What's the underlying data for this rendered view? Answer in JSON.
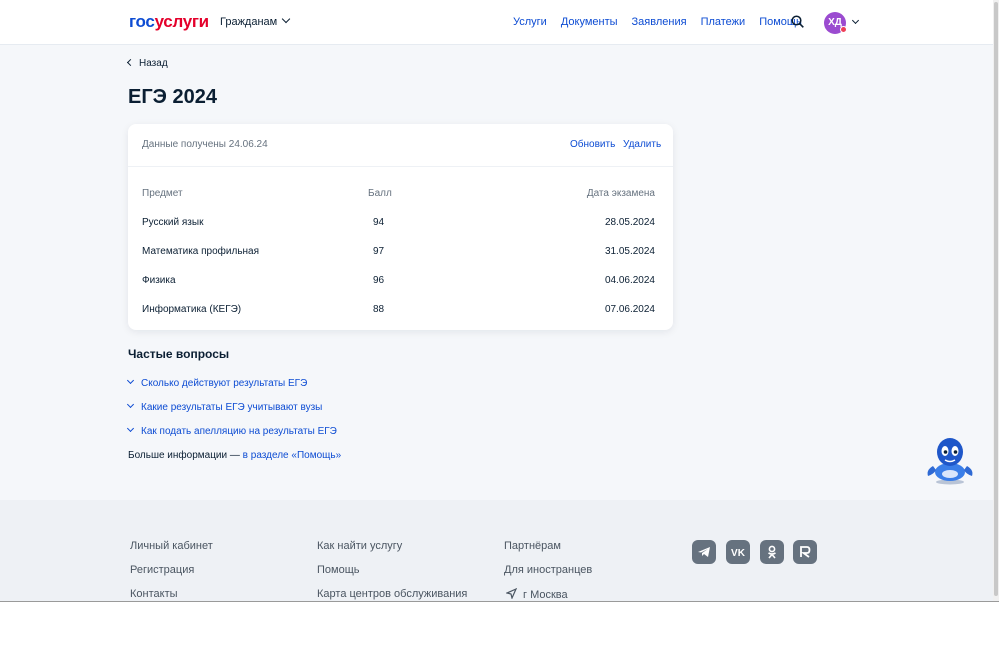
{
  "header": {
    "logo_part1": "гос",
    "logo_part2": "услуги",
    "role_selector": "Гражданам",
    "nav": [
      "Услуги",
      "Документы",
      "Заявления",
      "Платежи",
      "Помощь"
    ],
    "avatar_initials": "ХД"
  },
  "page": {
    "back_label": "Назад",
    "title": "ЕГЭ 2024"
  },
  "results_card": {
    "received_text": "Данные получены 24.06.24",
    "refresh_label": "Обновить",
    "delete_label": "Удалить",
    "columns": [
      "Предмет",
      "Балл",
      "Дата экзамена"
    ],
    "rows": [
      {
        "subject": "Русский язык",
        "score": "94",
        "date": "28.05.2024"
      },
      {
        "subject": "Математика профильная",
        "score": "97",
        "date": "31.05.2024"
      },
      {
        "subject": "Физика",
        "score": "96",
        "date": "04.06.2024"
      },
      {
        "subject": "Информатика (КЕГЭ)",
        "score": "88",
        "date": "07.06.2024"
      }
    ]
  },
  "faq": {
    "title": "Частые вопросы",
    "items": [
      "Сколько действуют результаты ЕГЭ",
      "Какие результаты ЕГЭ учитывают вузы",
      "Как подать апелляцию на результаты ЕГЭ"
    ],
    "more_prefix": "Больше информации — ",
    "more_link": "в разделе «Помощь»"
  },
  "footer": {
    "col1": [
      "Личный кабинет",
      "Регистрация",
      "Контакты"
    ],
    "col2": [
      "Как найти услугу",
      "Помощь",
      "Карта центров обслуживания"
    ],
    "col3": [
      "Партнёрам",
      "Для иностранцев"
    ],
    "location": "г Москва",
    "social_icons": [
      "telegram-icon",
      "vk-icon",
      "odnoklassniki-icon",
      "rutube-icon"
    ]
  },
  "colors": {
    "brand_blue": "#0d4cd3",
    "brand_red": "#e4002b",
    "text": "#0b1f33",
    "muted": "#66727f",
    "avatar": "#9b4bd0"
  }
}
